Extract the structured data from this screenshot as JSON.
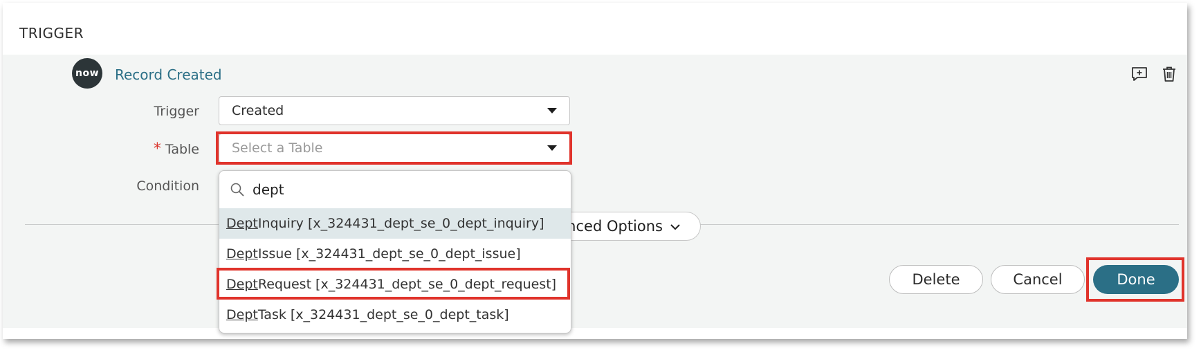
{
  "header": {
    "title": "TRIGGER"
  },
  "trigger_step": {
    "logo_text": "now",
    "name": "Record Created"
  },
  "form": {
    "trigger_label": "Trigger",
    "trigger_value": "Created",
    "table_label": "Table",
    "required_mark": "*",
    "table_placeholder": "Select a Table",
    "condition_label": "Condition"
  },
  "dropdown": {
    "search_value": "dept",
    "options": [
      {
        "match": "Dept",
        "rest": " Inquiry [x_324431_dept_se_0_dept_inquiry]"
      },
      {
        "match": "Dept",
        "rest": " Issue [x_324431_dept_se_0_dept_issue]"
      },
      {
        "match": "Dept",
        "rest": " Request [x_324431_dept_se_0_dept_request]"
      },
      {
        "match": "Dept",
        "rest": " Task [x_324431_dept_se_0_dept_task]"
      }
    ]
  },
  "advanced": {
    "label": "Show Advanced Options"
  },
  "actions": {
    "delete": "Delete",
    "cancel": "Cancel",
    "done": "Done"
  },
  "colors": {
    "accent": "#2b6f86",
    "highlight": "#e0332b",
    "required": "#d9342b"
  }
}
